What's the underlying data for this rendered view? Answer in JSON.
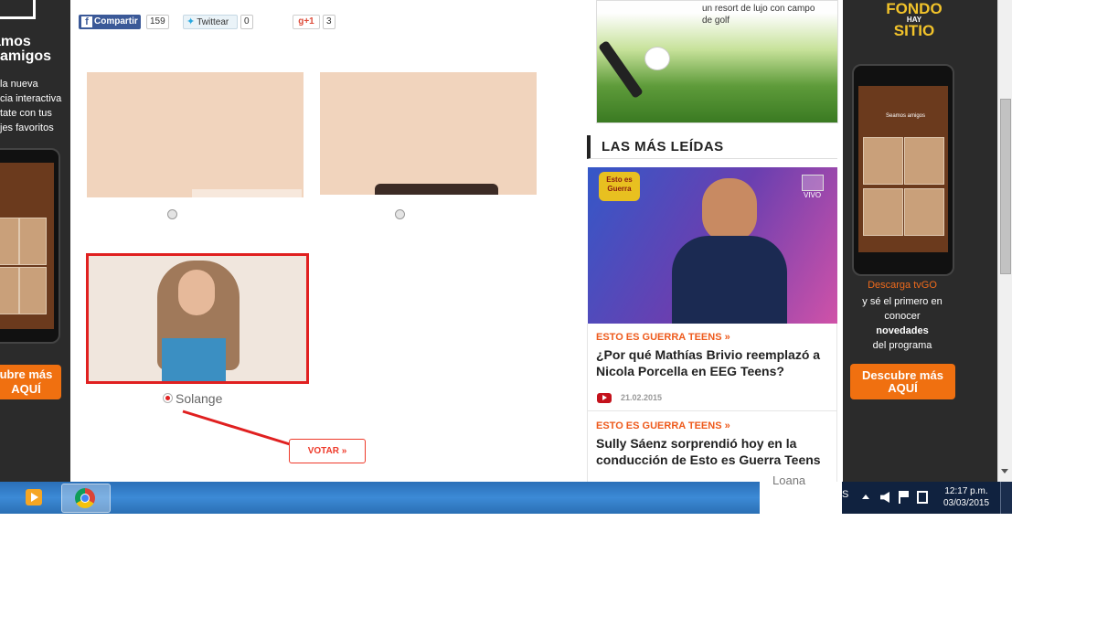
{
  "left_ad": {
    "title": "amos amigos",
    "text_lines": [
      "la nueva",
      "cia interactiva",
      "tate con tus",
      "jes favoritos"
    ],
    "button_label": "ubre más AQUÍ"
  },
  "social": {
    "facebook_label": "Compartir",
    "facebook_count": "159",
    "twitter_label": "Twittear",
    "twitter_count": "0",
    "gplus_label": "+1",
    "gplus_count": "3"
  },
  "gallery": {
    "selected_name": "Solange",
    "vote_label": "VOTAR »"
  },
  "sidebar": {
    "golf_ad_text": "un resort de lujo con campo de golf",
    "section_title": "LAS MÁS LEÍDAS",
    "video_badge": "VIVO",
    "show_logo_text": "Esto es Guerra",
    "articles": [
      {
        "tag": "ESTO ES GUERRA TEENS »",
        "headline": "¿Por qué Mathías Brivio reemplazó a Nicola Porcella en EEG Teens?",
        "date": "21.02.2015"
      },
      {
        "tag": "ESTO ES GUERRA TEENS »",
        "headline": "Sully Sáenz sorprendió hoy en la conducción de Esto es Guerra Teens"
      }
    ],
    "tooltip_text": "Loana"
  },
  "right_ad": {
    "logo_lines": [
      "FONDO",
      "HAY",
      "SITIO"
    ],
    "download_text": "Descarga tvGO",
    "body_lines": [
      "y sé el primero en",
      "conocer",
      "novedades",
      "del programa"
    ],
    "button_lines": [
      "Descubre más",
      "AQUÍ"
    ],
    "phone_screen_title": "Seamos amigos"
  },
  "taskbar": {
    "tray_letter": "S",
    "time": "12:17 p.m.",
    "date": "03/03/2015"
  },
  "colors": {
    "accent_orange": "#ee5a1c",
    "selection_red": "#e02020",
    "taskbar_blue": "#3c8ad6"
  }
}
